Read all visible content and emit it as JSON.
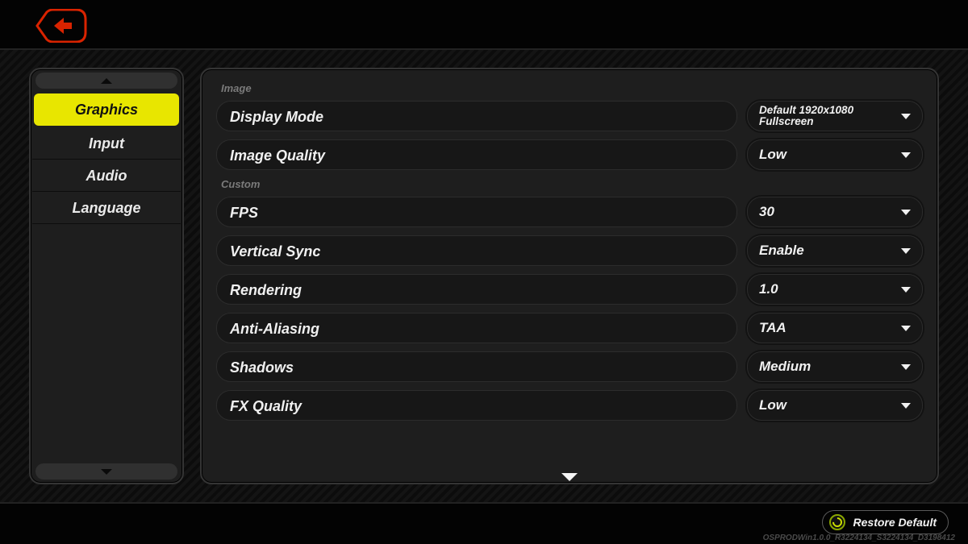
{
  "sidebar": {
    "items": [
      {
        "label": "Graphics",
        "active": true
      },
      {
        "label": "Input",
        "active": false
      },
      {
        "label": "Audio",
        "active": false
      },
      {
        "label": "Language",
        "active": false
      }
    ]
  },
  "sections": {
    "image_label": "Image",
    "custom_label": "Custom"
  },
  "settings": {
    "display_mode": {
      "label": "Display Mode",
      "value": "Default 1920x1080\nFullscreen"
    },
    "image_quality": {
      "label": "Image Quality",
      "value": "Low"
    },
    "fps": {
      "label": "FPS",
      "value": "30"
    },
    "vsync": {
      "label": "Vertical Sync",
      "value": "Enable"
    },
    "rendering": {
      "label": "Rendering",
      "value": "1.0"
    },
    "anti_aliasing": {
      "label": "Anti-Aliasing",
      "value": "TAA"
    },
    "shadows": {
      "label": "Shadows",
      "value": "Medium"
    },
    "fx_quality": {
      "label": "FX Quality",
      "value": "Low"
    }
  },
  "footer": {
    "restore_label": "Restore Default",
    "version": "OSPRODWin1.0.0_R3224134_S3224134_D3198412"
  }
}
